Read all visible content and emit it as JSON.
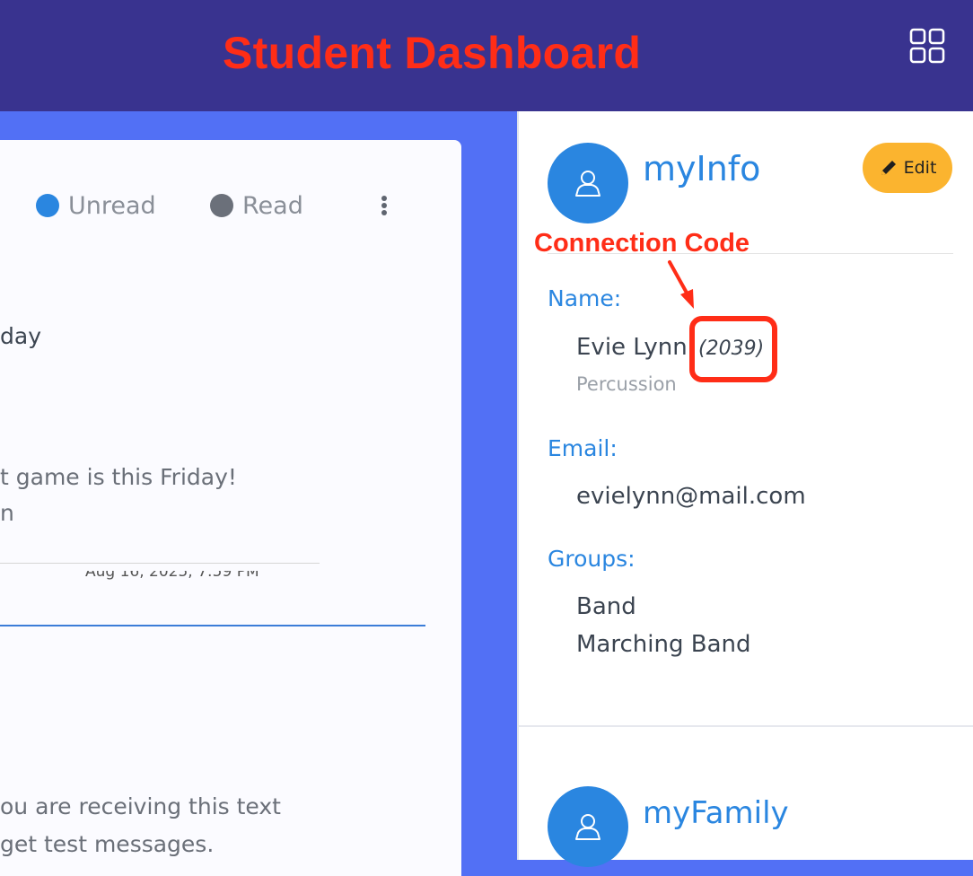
{
  "header": {
    "title": "Student Dashboard"
  },
  "messages": {
    "legend": {
      "unread_label": "Unread",
      "read_label": "Read",
      "unread_color": "#2a86e0",
      "read_color": "#6b707a"
    },
    "items": [
      {
        "title_fragment": "day",
        "body_lines": [
          "t game is this Friday!",
          "n"
        ],
        "date": "Aug 16, 2025, 7:59 PM"
      },
      {
        "body_lines": [
          "ou are receiving this text",
          "get test messages."
        ]
      }
    ]
  },
  "myinfo": {
    "title": "myInfo",
    "edit_label": "Edit",
    "name_label": "Name:",
    "name": "Evie Lynn",
    "connection_code": "(2039)",
    "instrument": "Percussion",
    "email_label": "Email:",
    "email": "evielynn@mail.com",
    "groups_label": "Groups:",
    "groups": [
      "Band",
      "Marching Band"
    ]
  },
  "myfamily": {
    "title": "myFamily"
  },
  "annotations": {
    "connection_code_label": "Connection Code",
    "color": "#ff2d17"
  },
  "colors": {
    "header_bg": "#39338f",
    "page_bg": "#5270f5",
    "accent": "#2a86e0",
    "edit_button": "#fbb42f"
  },
  "icons": {
    "apps": "grid-icon",
    "avatar": "user-icon",
    "edit": "pencil-icon",
    "menu": "kebab-icon"
  }
}
